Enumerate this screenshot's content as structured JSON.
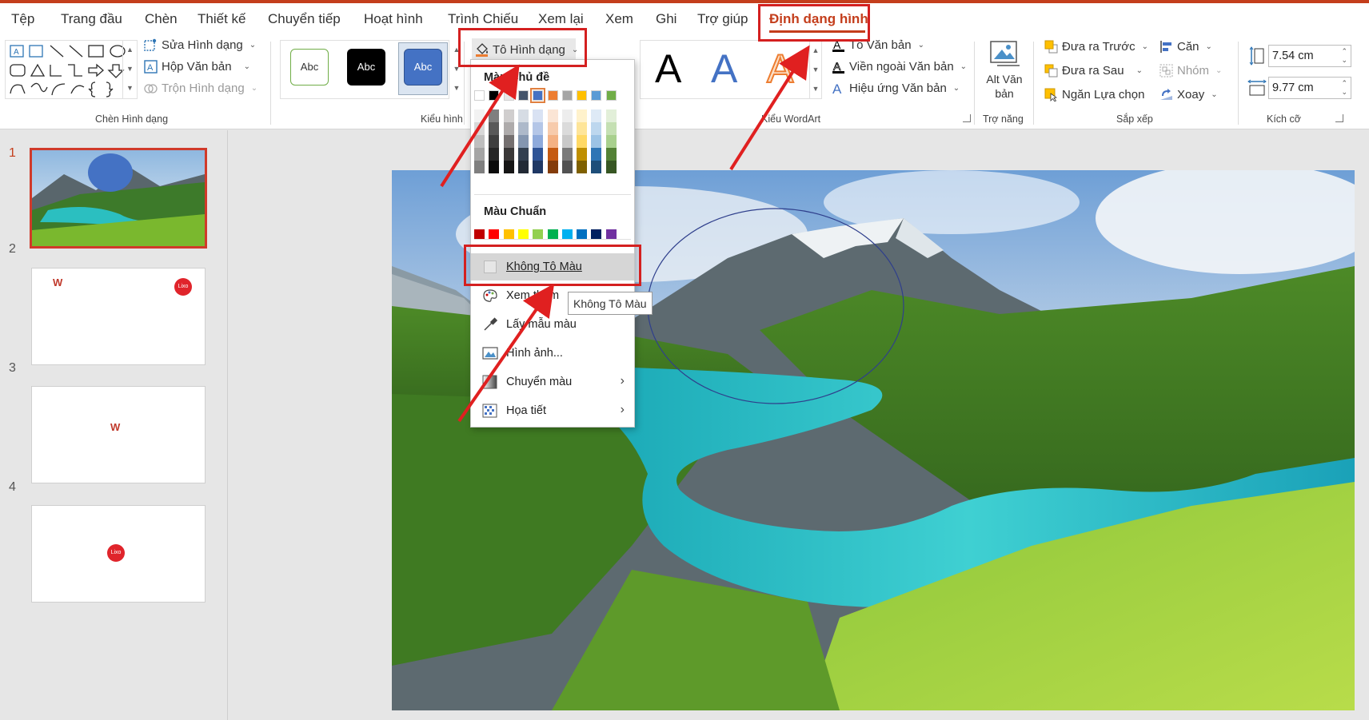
{
  "menu": {
    "items": [
      "Tệp",
      "Trang đầu",
      "Chèn",
      "Thiết kế",
      "Chuyển tiếp",
      "Hoạt hình",
      "Trình Chiếu",
      "Xem lại",
      "Xem",
      "Ghi",
      "Trợ giúp"
    ],
    "active_tab": "Định dạng hình"
  },
  "ribbon": {
    "insert_shapes": {
      "edit_shape": "Sửa Hình dạng",
      "text_box": "Hộp Văn bản",
      "merge_shapes": "Trộn Hình dạng",
      "label": "Chèn Hình dạng"
    },
    "shape_styles": {
      "previews": [
        "Abc",
        "Abc",
        "Abc"
      ],
      "fill_button": "Tô Hình dạng",
      "label": "Kiểu hình"
    },
    "wordart": {
      "letters": [
        "A",
        "A",
        "A"
      ],
      "text_fill": "Tô Văn bản",
      "text_outline": "Viền ngoài Văn bản",
      "text_effects": "Hiệu ứng Văn bản",
      "label": "Kiểu WordArt"
    },
    "accessibility": {
      "alt_text_line1": "Alt Văn",
      "alt_text_line2": "bản",
      "label": "Trợ năng"
    },
    "arrange": {
      "bring_forward": "Đưa ra Trước",
      "send_backward": "Đưa ra Sau",
      "selection_pane": "Ngăn Lựa chọn",
      "align": "Căn",
      "group": "Nhóm",
      "rotate": "Xoay",
      "label": "Sắp xếp"
    },
    "size": {
      "height": "7.54 cm",
      "width": "9.77 cm",
      "label": "Kích cỡ"
    }
  },
  "slides": {
    "numbers": [
      "1",
      "2",
      "3",
      "4"
    ],
    "logo_text": "Lixo"
  },
  "dropdown": {
    "theme_colors_header": "Màu Chủ đề",
    "standard_colors_header": "Màu Chuẩn",
    "no_fill": "Không Tô Màu",
    "more_colors": "Xem thêm Màu",
    "eyedropper": "Lấy mẫu màu",
    "picture": "Hình ảnh...",
    "gradient": "Chuyển màu",
    "texture": "Họa tiết",
    "theme_colors": [
      "#ffffff",
      "#000000",
      "#e7e6e6",
      "#44546a",
      "#4472c4",
      "#ed7d31",
      "#a5a5a5",
      "#ffc000",
      "#5b9bd5",
      "#70ad47"
    ],
    "theme_shades": [
      [
        "#f2f2f2",
        "#7f7f7f",
        "#d0cece",
        "#d6dce4",
        "#d9e2f3",
        "#fbe5d5",
        "#ededed",
        "#fff2cc",
        "#deeaf6",
        "#e2efd9"
      ],
      [
        "#d8d8d8",
        "#595959",
        "#aeabab",
        "#adb9ca",
        "#b4c6e7",
        "#f7cbac",
        "#dbdbdb",
        "#fee599",
        "#bdd7ee",
        "#c5e0b3"
      ],
      [
        "#bfbfbf",
        "#3f3f3f",
        "#757070",
        "#8496b0",
        "#8eaadb",
        "#f4b183",
        "#c9c9c9",
        "#ffd965",
        "#9cc3e5",
        "#a8d08d"
      ],
      [
        "#a5a5a5",
        "#262626",
        "#3a3838",
        "#323f4f",
        "#2f5496",
        "#c55a11",
        "#7b7b7b",
        "#bf8f00",
        "#2e75b5",
        "#538135"
      ],
      [
        "#7f7f7f",
        "#0c0c0c",
        "#161616",
        "#222a35",
        "#1f3864",
        "#843c0b",
        "#525252",
        "#7f6000",
        "#1e4e79",
        "#375623"
      ]
    ],
    "standard_colors": [
      "#c00000",
      "#ff0000",
      "#ffc000",
      "#ffff00",
      "#92d050",
      "#00b050",
      "#00b0f0",
      "#0070c0",
      "#002060",
      "#7030a0"
    ]
  },
  "tooltip": "Không Tô Màu",
  "colors": {
    "accent": "#c43e1c",
    "highlight_red": "#d42020",
    "shape_blue": "#4472c4"
  }
}
